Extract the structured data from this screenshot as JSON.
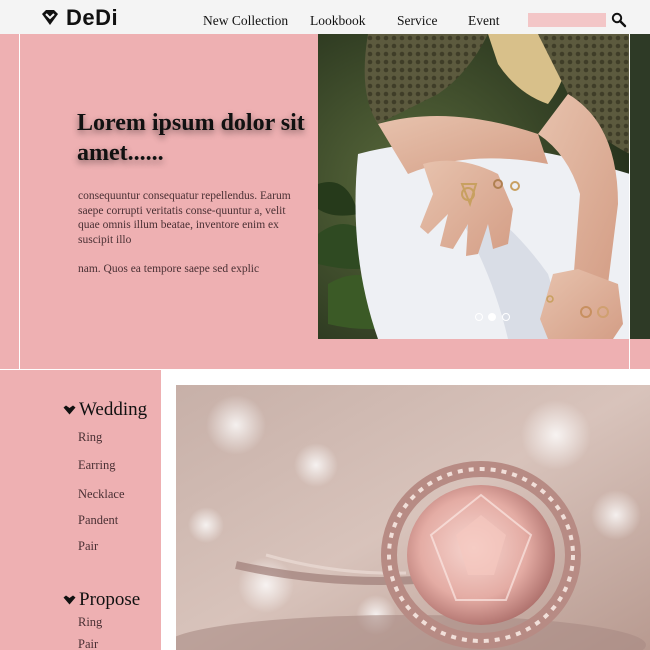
{
  "brand": {
    "name": "DeDi",
    "icon": "diamond-heart-icon"
  },
  "nav": {
    "items": [
      {
        "label": "New Collection",
        "name": "nav-new-collection"
      },
      {
        "label": "Lookbook",
        "name": "nav-lookbook"
      },
      {
        "label": "Service",
        "name": "nav-service"
      },
      {
        "label": "Event",
        "name": "nav-event"
      }
    ],
    "search_value": "",
    "search_icon": "magnifier-icon"
  },
  "hero": {
    "title": "Lorem ipsum dolor sit amet......",
    "paragraph1": "consequuntur consequatur repellendus. Earum saepe corrupti veritatis conse-quuntur a, velit quae omnis illum beatae, inventore enim ex suscipit illo",
    "paragraph2": "nam. Quos ea tempore saepe sed explic",
    "carousel": {
      "slide_count": 3,
      "active_index": 1
    }
  },
  "sidebar": {
    "sections": [
      {
        "title": "Wedding",
        "items": [
          "Ring",
          "Earring",
          "Necklace",
          "Pandent",
          "Pair"
        ]
      },
      {
        "title": "Propose",
        "items": [
          "Ring",
          "Pair"
        ]
      }
    ]
  },
  "colors": {
    "accent_pink": "#eeb0b2",
    "search_pink": "#f3c6c7",
    "header_bg": "#f4f4f4",
    "text_dark": "#111111"
  }
}
